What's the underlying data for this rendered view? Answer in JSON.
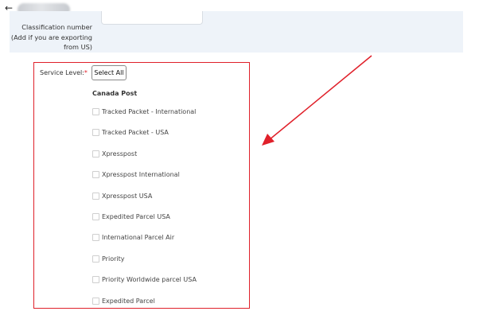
{
  "header": {
    "back_icon": "←",
    "title_redacted": true
  },
  "classification": {
    "label_lines": [
      "Classification number",
      "(Add if you are exporting",
      "from US)"
    ],
    "value": ""
  },
  "service_level": {
    "label": "Service Level:",
    "required_mark": "*",
    "select_all_label": "Select All",
    "group_title": "Canada Post",
    "options": [
      {
        "label": "Tracked Packet - International",
        "checked": false
      },
      {
        "label": "Tracked Packet - USA",
        "checked": false
      },
      {
        "label": "Xpresspost",
        "checked": false
      },
      {
        "label": "Xpresspost International",
        "checked": false
      },
      {
        "label": "Xpresspost USA",
        "checked": false
      },
      {
        "label": "Expedited Parcel USA",
        "checked": false
      },
      {
        "label": "International Parcel Air",
        "checked": false
      },
      {
        "label": "Priority",
        "checked": false
      },
      {
        "label": "Priority Worldwide parcel USA",
        "checked": false
      },
      {
        "label": "Expedited Parcel",
        "checked": false
      }
    ]
  },
  "annotation": {
    "highlight_color": "#e0202a",
    "arrow_color": "#e0202a"
  }
}
